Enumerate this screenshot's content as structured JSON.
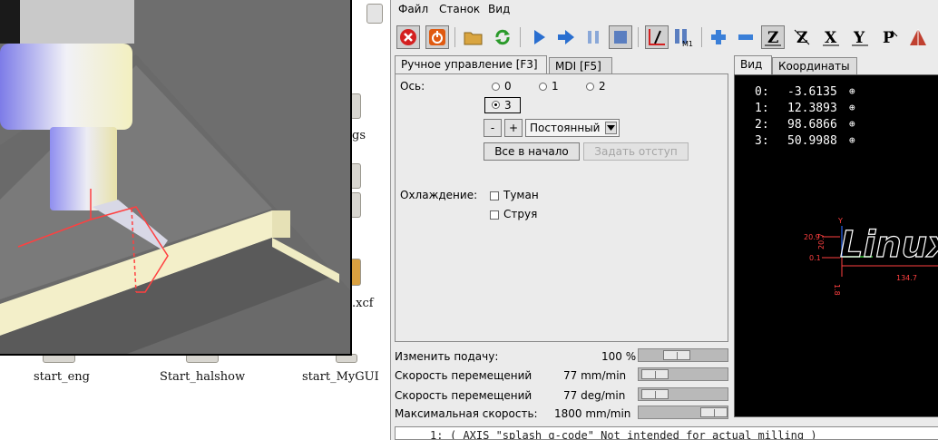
{
  "desktop": {
    "icons": [
      {
        "label": "start_eng"
      },
      {
        "label": "Start_halshow"
      },
      {
        "label": "start_MyGUI"
      }
    ],
    "partial_labels": {
      "gs": "gs",
      "xcf": ".xcf"
    }
  },
  "menu": [
    "Файл",
    "Станок",
    "Вид"
  ],
  "toolbar": {
    "icons": [
      "estop-icon",
      "power-icon",
      "open-file-icon",
      "reload-icon",
      "run-icon",
      "step-icon",
      "pause-icon",
      "stop-icon",
      "block-delete-icon",
      "optional-stop-icon",
      "zoom-in-icon",
      "zoom-out-icon",
      "view-z-icon",
      "view-z2-icon",
      "view-x-icon",
      "view-y-icon",
      "view-p-icon",
      "clear-plot-icon"
    ],
    "labels": {
      "z": "Z",
      "z2": "Z",
      "x": "X",
      "y": "Y",
      "p": "P",
      "m1": "M1"
    }
  },
  "tabs_left": [
    {
      "label": "Ручное управление [F3]"
    },
    {
      "label": "MDI [F5]"
    }
  ],
  "manual": {
    "axis_label": "Ось:",
    "axes": [
      "0",
      "1",
      "2",
      "3"
    ],
    "selected_axis": "3",
    "minus_label": "-",
    "plus_label": "+",
    "jog_mode": "Постоянный",
    "home_all": "Все в начало",
    "touch_off": "Задать отступ",
    "coolant_label": "Охлаждение:",
    "mist": "Туман",
    "flood": "Струя"
  },
  "sliders": [
    {
      "label": "Изменить подачу:",
      "value": "100 %",
      "level": 0.4
    },
    {
      "label": "Скорость перемещений",
      "value": "77 mm/min",
      "level": 0.05
    },
    {
      "label": "Скорость перемещений",
      "value": "77 deg/min",
      "level": 0.05
    },
    {
      "label": "Максимальная скорость:",
      "value": "1800 mm/min",
      "level": 1.0
    }
  ],
  "tabs_right": [
    {
      "label": "Вид"
    },
    {
      "label": "Координаты"
    }
  ],
  "dro": [
    {
      "axis": "0:",
      "value": "-3.6135"
    },
    {
      "axis": "1:",
      "value": "12.3893"
    },
    {
      "axis": "2:",
      "value": "98.6866"
    },
    {
      "axis": "3:",
      "value": "50.9988"
    }
  ],
  "preview": {
    "logo_text": "LinuxC",
    "dim_labels": [
      "20.9",
      "20.7",
      "0.1",
      "134.7",
      "1.8"
    ],
    "axis_y": "Y"
  },
  "gcode_line": {
    "number": "1:",
    "text": "( AXIS \"splash g-code\" Not intended for actual milling )"
  },
  "colors": {
    "estop": "#d42020",
    "power": "#e05a10",
    "accent": "#2a6fd0",
    "toolpath": "#ff4040"
  }
}
